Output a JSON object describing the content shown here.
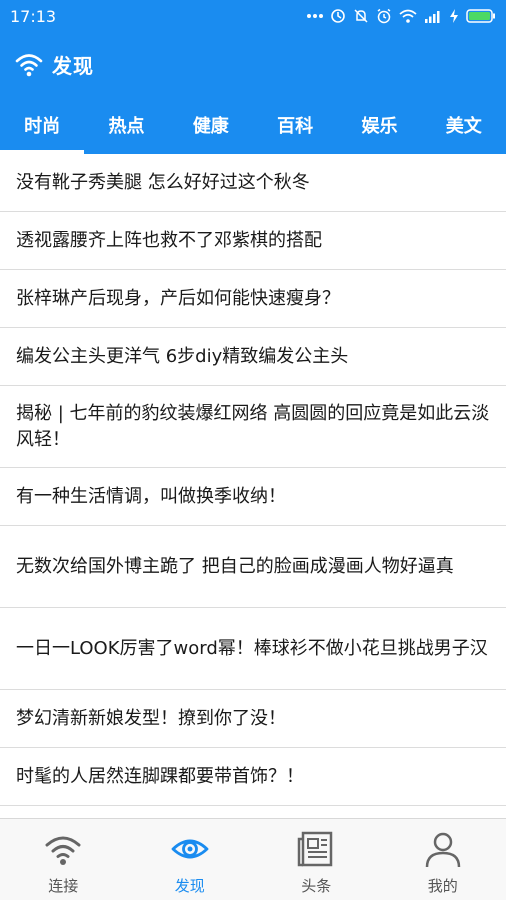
{
  "colors": {
    "primary": "#1A8CF0",
    "nav_inactive": "#666666"
  },
  "statusbar": {
    "time": "17:13",
    "icons": [
      "dots-icon",
      "alarm-off-icon",
      "mute-icon",
      "alarm-icon",
      "wifi-icon",
      "signal-icon",
      "charging-icon",
      "battery-icon"
    ],
    "battery_level": 1.0
  },
  "header": {
    "title": "发现",
    "icon": "wifi-icon"
  },
  "tabs": [
    {
      "label": "时尚",
      "active": true
    },
    {
      "label": "热点",
      "active": false
    },
    {
      "label": "健康",
      "active": false
    },
    {
      "label": "百科",
      "active": false
    },
    {
      "label": "娱乐",
      "active": false
    },
    {
      "label": "美文",
      "active": false
    }
  ],
  "articles": [
    {
      "title": "没有靴子秀美腿 怎么好好过这个秋冬"
    },
    {
      "title": "透视露腰齐上阵也救不了邓紫棋的搭配"
    },
    {
      "title": "张梓琳产后现身，产后如何能快速瘦身？"
    },
    {
      "title": "编发公主头更洋气 6步diy精致编发公主头"
    },
    {
      "title": "揭秘 | 七年前的豹纹装爆红网络 高圆圆的回应竟是如此云淡风轻！"
    },
    {
      "title": "有一种生活情调，叫做换季收纳！"
    },
    {
      "title": "无数次给国外博主跪了 把自己的脸画成漫画人物好逼真"
    },
    {
      "title": "一日一LOOK厉害了word幂！棒球衫不做小花旦挑战男子汉"
    },
    {
      "title": "梦幻清新新娘发型！撩到你了没！"
    },
    {
      "title": "时髦的人居然连脚踝都要带首饰？！"
    }
  ],
  "bottom_nav": [
    {
      "label": "连接",
      "icon": "wifi-icon",
      "active": false
    },
    {
      "label": "发现",
      "icon": "eye-icon",
      "active": true
    },
    {
      "label": "头条",
      "icon": "newspaper-icon",
      "active": false
    },
    {
      "label": "我的",
      "icon": "person-icon",
      "active": false
    }
  ]
}
